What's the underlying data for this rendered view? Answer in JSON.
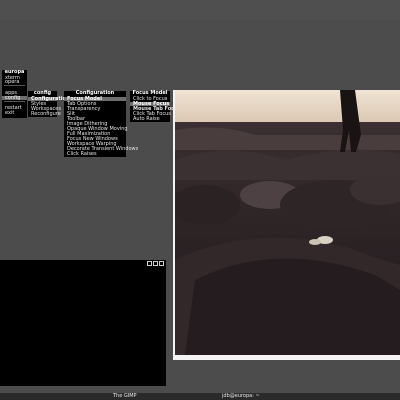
{
  "root_menu": {
    "title": "europa",
    "items": [
      "xterm",
      "opera",
      "apps",
      "config",
      "restart",
      "exit"
    ]
  },
  "config_menu": {
    "title": "config",
    "items": [
      "Configuration",
      "Styles",
      "Workspaces",
      "Reconfigure"
    ]
  },
  "configuration_menu": {
    "title": "Configuration",
    "items": [
      "Focus Model",
      "Tab Options",
      "Transparency",
      "Slit",
      "Toolbar",
      "Image Dithering",
      "Opaque Window Moving",
      "Full Maximization",
      "Focus New Windows",
      "Workspace Warping",
      "Decorate Transient Windows",
      "Click Raises"
    ]
  },
  "focus_menu": {
    "title": "Focus Model",
    "items": [
      "Click to Focus",
      "Mouse Focus",
      "Mouse Tab Focus",
      "Click Tab Focus",
      "Auto Raise"
    ]
  },
  "taskbar": {
    "left_label": "The GIMP",
    "right_label": "jdb@europa: ~"
  },
  "terminal": {
    "controls": [
      "minimize-icon",
      "maximize-icon",
      "close-icon"
    ]
  },
  "colors": {
    "desktop": "#4c4c4c",
    "menu_bg": "#000000",
    "menu_selected": "#6f6f6f",
    "photo_frame": "#f4f4f4"
  }
}
